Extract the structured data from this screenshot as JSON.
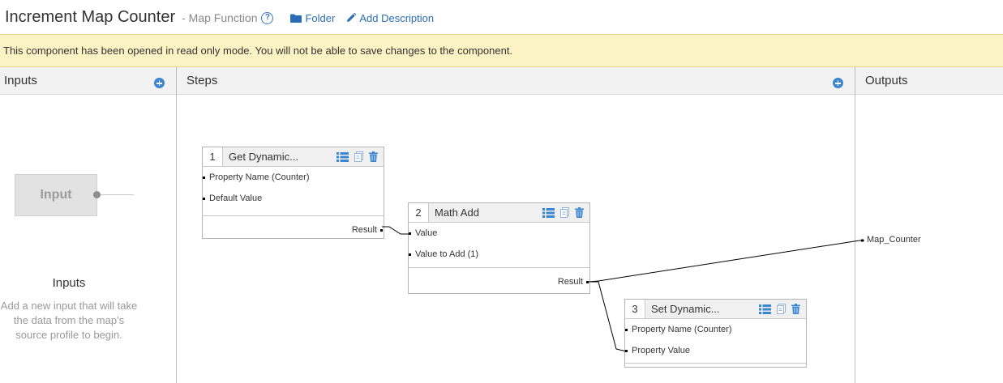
{
  "header": {
    "title": "Increment Map Counter",
    "subtitle": "- Map Function",
    "help_icon": "?",
    "folder_label": "Folder",
    "add_description_label": "Add Description"
  },
  "banner": {
    "message": "This component has been opened in read only mode. You will not be able to save changes to the component."
  },
  "columns": {
    "inputs": "Inputs",
    "steps": "Steps",
    "outputs": "Outputs"
  },
  "inputs_panel": {
    "placeholder_label": "Input",
    "heading": "Inputs",
    "description": "Add a new input that will take the data from the map's source profile to begin."
  },
  "steps": [
    {
      "number": "1",
      "title": "Get Dynamic...",
      "inputs": [
        "Property Name (Counter)",
        "Default Value"
      ],
      "outputs": [
        "Result"
      ]
    },
    {
      "number": "2",
      "title": "Math Add",
      "inputs": [
        "Value",
        "Value to Add (1)"
      ],
      "outputs": [
        "Result"
      ]
    },
    {
      "number": "3",
      "title": "Set Dynamic...",
      "inputs": [
        "Property Name (Counter)",
        "Property Value"
      ],
      "outputs": []
    }
  ],
  "outputs": [
    "Map_Counter"
  ],
  "colors": {
    "link": "#2a6db5",
    "banner_background": "#fcf3c4",
    "action_icon": "#3a86d0",
    "column_header": "#f2f2f2"
  },
  "icons": {
    "folder": "folder-icon",
    "add_description": "pencil-icon",
    "add_input": "plus-circle-icon",
    "add_step": "plus-circle-icon",
    "step_list": "list-icon",
    "step_copy": "copy-icon",
    "step_delete": "trash-icon"
  }
}
